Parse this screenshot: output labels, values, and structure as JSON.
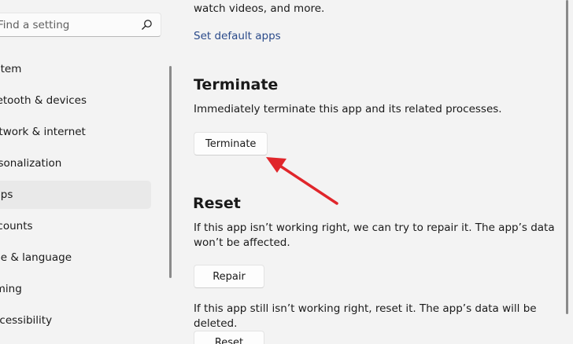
{
  "sidebar": {
    "search": {
      "placeholder": "Find a setting"
    },
    "items": [
      {
        "label": "System"
      },
      {
        "label": "Bluetooth & devices"
      },
      {
        "label": "Network & internet"
      },
      {
        "label": "Personalization"
      },
      {
        "label": "Apps"
      },
      {
        "label": "Accounts"
      },
      {
        "label": "Time & language"
      },
      {
        "label": "Gaming"
      },
      {
        "label": "Accessibility"
      }
    ],
    "selected_index": 4
  },
  "main": {
    "intro_text": "watch videos, and more.",
    "default_apps_link": "Set default apps",
    "terminate": {
      "title": "Terminate",
      "description": "Immediately terminate this app and its related processes.",
      "button_label": "Terminate"
    },
    "reset": {
      "title": "Reset",
      "repair_description": "If this app isn’t working right, we can try to repair it. The app’s data won’t be affected.",
      "repair_button_label": "Repair",
      "reset_description": "If this app still isn’t working right, reset it. The app’s data will be deleted.",
      "reset_button_label": "Reset"
    }
  },
  "colors": {
    "background": "#f3f3f3",
    "link": "#2a4a8a",
    "annotation_arrow": "#e0262b",
    "selected_nav": "#e9e9e9"
  },
  "icons": {
    "search": "search-icon",
    "annotation": "red-arrow-icon"
  }
}
